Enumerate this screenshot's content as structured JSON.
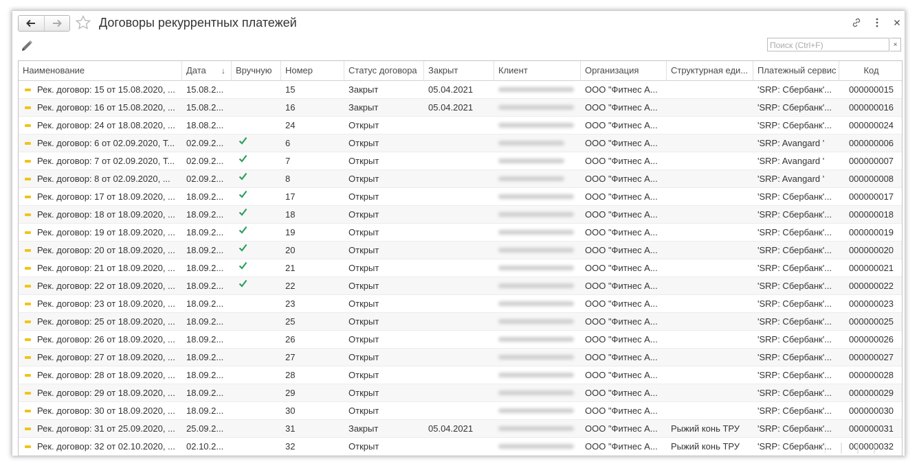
{
  "window": {
    "title": "Договоры рекуррентных платежей"
  },
  "search": {
    "placeholder": "Поиск (Ctrl+F)",
    "clear_label": "×"
  },
  "columns": [
    "Наименование",
    "Дата",
    "Вручную",
    "Номер",
    "Статус договора",
    "Закрыт",
    "Клиент",
    "Организация",
    "Структурная еди...",
    "Платежный сервис",
    "Код"
  ],
  "sort_indicator": "↓",
  "rows": [
    {
      "name": "Рек. договор: 15 от 15.08.2020, ...",
      "date": "15.08.2...",
      "manual": false,
      "number": "15",
      "status": "Закрыт",
      "closed": "05.04.2021",
      "org": "ООО \"Фитнес А...",
      "unit": "",
      "service": "'SRP: Сбербанк'...",
      "code": "000000015"
    },
    {
      "name": "Рек. договор: 16 от 15.08.2020, ...",
      "date": "15.08.2...",
      "manual": false,
      "number": "16",
      "status": "Закрыт",
      "closed": "05.04.2021",
      "org": "ООО \"Фитнес А...",
      "unit": "",
      "service": "'SRP: Сбербанк'...",
      "code": "000000016"
    },
    {
      "name": "Рек. договор: 24 от 18.08.2020, ...",
      "date": "18.08.2...",
      "manual": false,
      "number": "24",
      "status": "Открыт",
      "closed": "",
      "org": "ООО \"Фитнес А...",
      "unit": "",
      "service": "'SRP: Сбербанк'...",
      "code": "000000024"
    },
    {
      "name": "Рек. договор: 6 от 02.09.2020, Т...",
      "date": "02.09.2...",
      "manual": true,
      "number": "6",
      "status": "Открыт",
      "closed": "",
      "org": "ООО \"Фитнес А...",
      "unit": "",
      "service": "'SRP: Avangard '",
      "code": "000000006"
    },
    {
      "name": "Рек. договор: 7 от 02.09.2020, Т...",
      "date": "02.09.2...",
      "manual": true,
      "number": "7",
      "status": "Открыт",
      "closed": "",
      "org": "ООО \"Фитнес А...",
      "unit": "",
      "service": "'SRP: Avangard '",
      "code": "000000007"
    },
    {
      "name": "Рек. договор: 8 от 02.09.2020, ...",
      "date": "02.09.2...",
      "manual": true,
      "number": "8",
      "status": "Открыт",
      "closed": "",
      "org": "ООО \"Фитнес А...",
      "unit": "",
      "service": "'SRP: Avangard '",
      "code": "000000008"
    },
    {
      "name": "Рек. договор: 17 от 18.09.2020, ...",
      "date": "18.09.2...",
      "manual": true,
      "number": "17",
      "status": "Открыт",
      "closed": "",
      "org": "ООО \"Фитнес А...",
      "unit": "",
      "service": "'SRP: Сбербанк'...",
      "code": "000000017"
    },
    {
      "name": "Рек. договор: 18 от 18.09.2020, ...",
      "date": "18.09.2...",
      "manual": true,
      "number": "18",
      "status": "Открыт",
      "closed": "",
      "org": "ООО \"Фитнес А...",
      "unit": "",
      "service": "'SRP: Сбербанк'...",
      "code": "000000018"
    },
    {
      "name": "Рек. договор: 19 от 18.09.2020, ...",
      "date": "18.09.2...",
      "manual": true,
      "number": "19",
      "status": "Открыт",
      "closed": "",
      "org": "ООО \"Фитнес А...",
      "unit": "",
      "service": "'SRP: Сбербанк'...",
      "code": "000000019"
    },
    {
      "name": "Рек. договор: 20 от 18.09.2020, ...",
      "date": "18.09.2...",
      "manual": true,
      "number": "20",
      "status": "Открыт",
      "closed": "",
      "org": "ООО \"Фитнес А...",
      "unit": "",
      "service": "'SRP: Сбербанк'...",
      "code": "000000020"
    },
    {
      "name": "Рек. договор: 21 от 18.09.2020, ...",
      "date": "18.09.2...",
      "manual": true,
      "number": "21",
      "status": "Открыт",
      "closed": "",
      "org": "ООО \"Фитнес А...",
      "unit": "",
      "service": "'SRP: Сбербанк'...",
      "code": "000000021"
    },
    {
      "name": "Рек. договор: 22 от 18.09.2020, ...",
      "date": "18.09.2...",
      "manual": true,
      "number": "22",
      "status": "Открыт",
      "closed": "",
      "org": "ООО \"Фитнес А...",
      "unit": "",
      "service": "'SRP: Сбербанк'...",
      "code": "000000022"
    },
    {
      "name": "Рек. договор: 23 от 18.09.2020, ...",
      "date": "18.09.2...",
      "manual": false,
      "number": "23",
      "status": "Открыт",
      "closed": "",
      "org": "ООО \"Фитнес А...",
      "unit": "",
      "service": "'SRP: Сбербанк'...",
      "code": "000000023"
    },
    {
      "name": "Рек. договор: 25 от 18.09.2020, ...",
      "date": "18.09.2...",
      "manual": false,
      "number": "25",
      "status": "Открыт",
      "closed": "",
      "org": "ООО \"Фитнес А...",
      "unit": "",
      "service": "'SRP: Сбербанк'...",
      "code": "000000025"
    },
    {
      "name": "Рек. договор: 26 от 18.09.2020, ...",
      "date": "18.09.2...",
      "manual": false,
      "number": "26",
      "status": "Открыт",
      "closed": "",
      "org": "ООО \"Фитнес А...",
      "unit": "",
      "service": "'SRP: Сбербанк'...",
      "code": "000000026"
    },
    {
      "name": "Рек. договор: 27 от 18.09.2020, ...",
      "date": "18.09.2...",
      "manual": false,
      "number": "27",
      "status": "Открыт",
      "closed": "",
      "org": "ООО \"Фитнес А...",
      "unit": "",
      "service": "'SRP: Сбербанк'...",
      "code": "000000027"
    },
    {
      "name": "Рек. договор: 28 от 18.09.2020, ...",
      "date": "18.09.2...",
      "manual": false,
      "number": "28",
      "status": "Открыт",
      "closed": "",
      "org": "ООО \"Фитнес А...",
      "unit": "",
      "service": "'SRP: Сбербанк'...",
      "code": "000000028"
    },
    {
      "name": "Рек. договор: 29 от 18.09.2020, ...",
      "date": "18.09.2...",
      "manual": false,
      "number": "29",
      "status": "Открыт",
      "closed": "",
      "org": "ООО \"Фитнес А...",
      "unit": "",
      "service": "'SRP: Сбербанк'...",
      "code": "000000029"
    },
    {
      "name": "Рек. договор: 30 от 18.09.2020, ...",
      "date": "18.09.2...",
      "manual": false,
      "number": "30",
      "status": "Открыт",
      "closed": "",
      "org": "ООО \"Фитнес А...",
      "unit": "",
      "service": "'SRP: Сбербанк'...",
      "code": "000000030"
    },
    {
      "name": "Рек. договор: 31 от 25.09.2020, ...",
      "date": "25.09.2...",
      "manual": false,
      "number": "31",
      "status": "Закрыт",
      "closed": "05.04.2021",
      "org": "ООО \"Фитнес А...",
      "unit": "Рыжий конь ТРУ",
      "service": "'SRP: Сбербанк'...",
      "code": "000000031"
    },
    {
      "name": "Рек. договор: 32 от 02.10.2020, ...",
      "date": "02.10.2...",
      "manual": false,
      "number": "32",
      "status": "Открыт",
      "closed": "",
      "org": "ООО \"Фитнес А...",
      "unit": "Рыжий конь ТРУ",
      "service": "'SRP: Сбербанк'...",
      "code": "000000032"
    }
  ],
  "colors": {
    "check": "#2aa05a",
    "row_icon": "#f0c419",
    "alt_row": "#f7f7f7"
  }
}
